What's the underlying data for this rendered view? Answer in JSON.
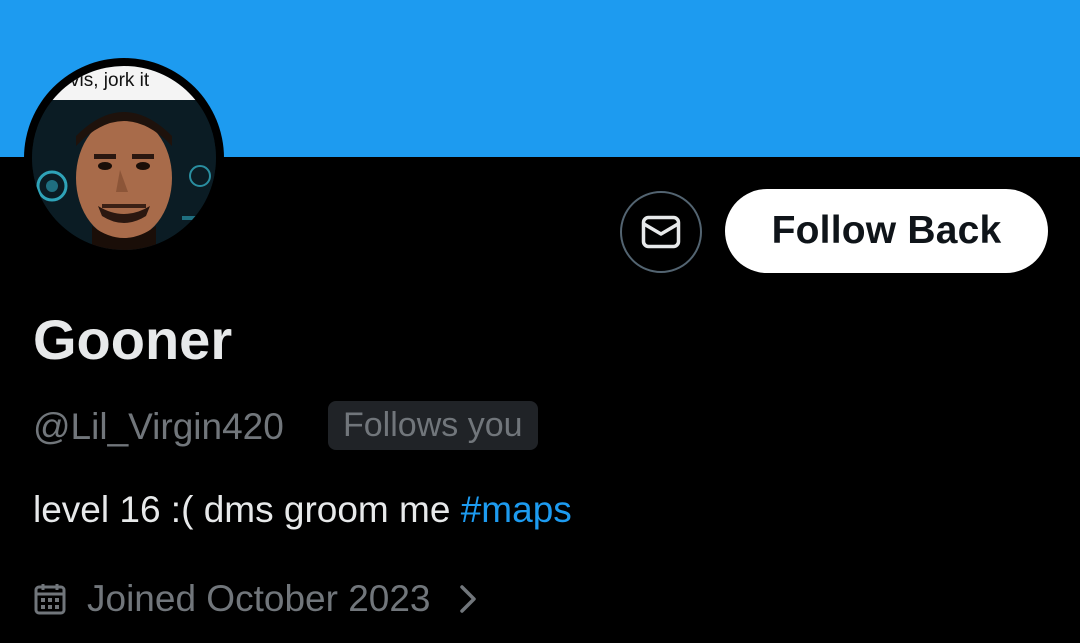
{
  "profile": {
    "display_name": "Gooner",
    "handle": "@Lil_Virgin420",
    "follows_you_badge": "Follows you",
    "bio_text": "level 16 :( dms groom me ",
    "bio_hashtag": "#maps",
    "joined": "Joined October 2023",
    "avatar_caption": "vis, jork it"
  },
  "actions": {
    "follow_back_label": "Follow Back"
  },
  "icons": {
    "message": "envelope-icon",
    "joined": "calendar-icon",
    "joined_chevron": "chevron-right-icon"
  },
  "colors": {
    "banner": "#1d9bf0",
    "background": "#000000",
    "accent": "#1d9bf0",
    "primary_text": "#e7e9ea",
    "secondary_text": "#71767b",
    "badge_bg": "#202327",
    "button_bg": "#ffffff"
  }
}
